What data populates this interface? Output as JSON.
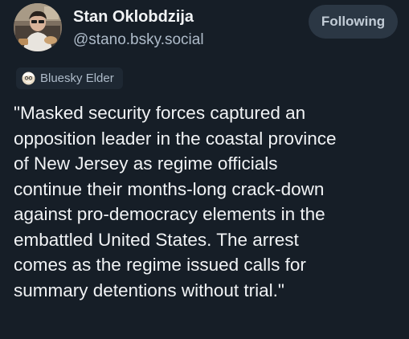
{
  "author": {
    "display_name": "Stan Oklobdzija",
    "handle": "@stano.bsky.social",
    "avatar_icon": "user-photo-avatar"
  },
  "follow_button": {
    "label": "Following"
  },
  "badge": {
    "icon": "elder-face-icon",
    "label": "Bluesky Elder"
  },
  "post": {
    "lines": [
      "\"Masked security forces captured an",
      "opposition leader in the coastal province",
      "of New Jersey as regime officials",
      "continue their months-long crack-down",
      "against pro-democracy elements in the",
      "embattled United States. The arrest",
      "comes as the regime issued calls for",
      "summary detentions without trial.\""
    ]
  },
  "colors": {
    "background": "#161e27",
    "text": "#f1f3f5",
    "muted": "#aebbc9",
    "button_bg": "#2b3744",
    "badge_bg": "#1e2833"
  }
}
